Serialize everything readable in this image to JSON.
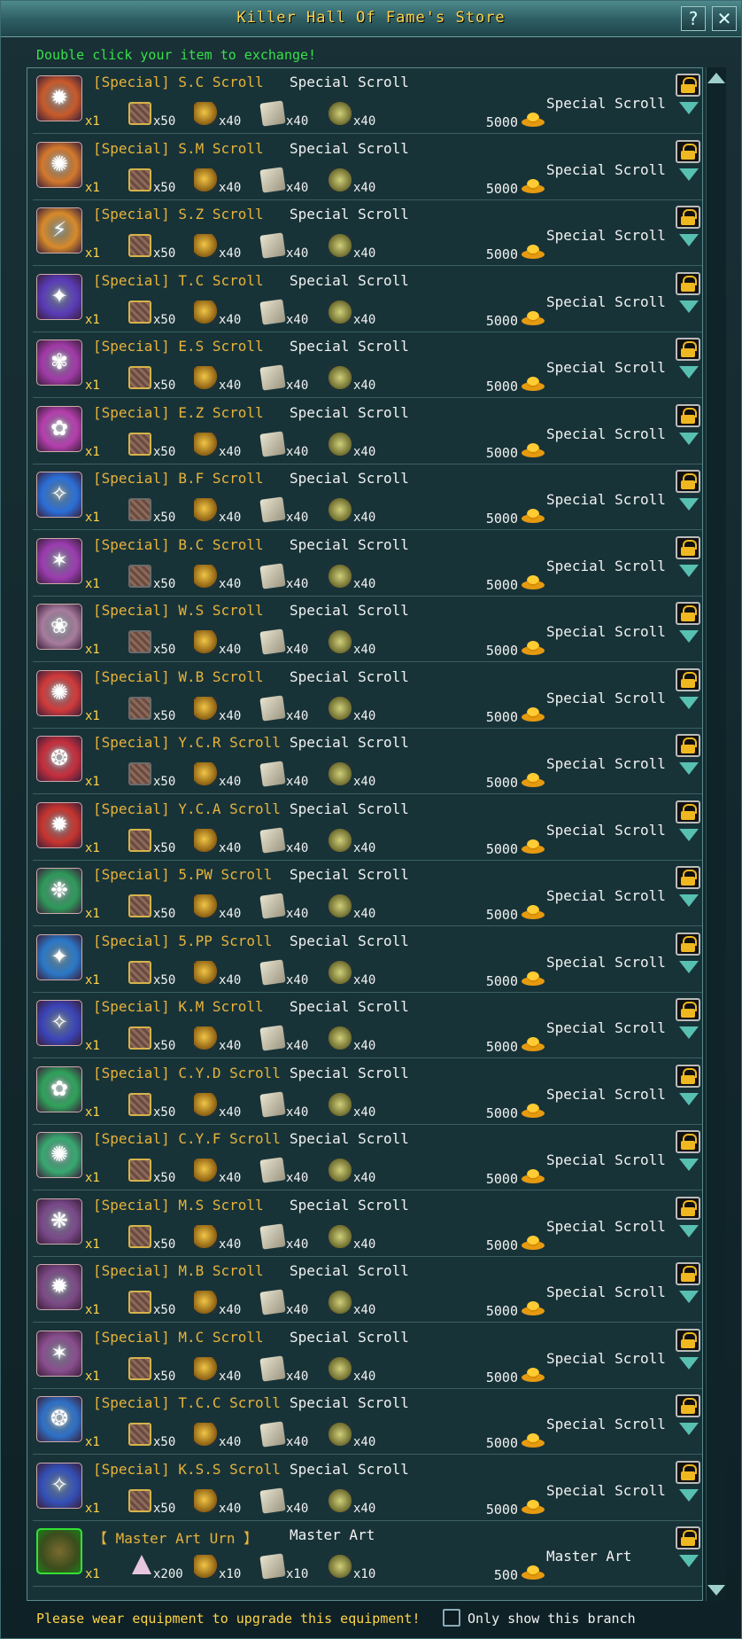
{
  "window": {
    "title": "Killer Hall Of Fame's Store",
    "help_glyph": "?",
    "close_glyph": "✕"
  },
  "hint_top": "Double click your item to exchange!",
  "footer": {
    "hint": "Please wear equipment to upgrade this equipment!",
    "checkbox_label": "Only show this branch"
  },
  "colors": {
    "item_name": "#e7b33a",
    "hint_top": "#38e04b",
    "footer_hint": "#ffd34a",
    "lock_icon": "#f0b820",
    "arrow_icon": "#58c0b0"
  },
  "items": [
    {
      "name": "[Special] S.C Scroll",
      "type": "Special Scroll",
      "qty": "x1",
      "mats": [
        "x50",
        "x40",
        "x40",
        "x40"
      ],
      "price": "5000",
      "category": "Special Scroll",
      "icon_color": "#c85a2a",
      "icon": "✹"
    },
    {
      "name": "[Special] S.M Scroll",
      "type": "Special Scroll",
      "qty": "x1",
      "mats": [
        "x50",
        "x40",
        "x40",
        "x40"
      ],
      "price": "5000",
      "category": "Special Scroll",
      "icon_color": "#d4782c",
      "icon": "✺"
    },
    {
      "name": "[Special] S.Z Scroll",
      "type": "Special Scroll",
      "qty": "x1",
      "mats": [
        "x50",
        "x40",
        "x40",
        "x40"
      ],
      "price": "5000",
      "category": "Special Scroll",
      "icon_color": "#d88a2a",
      "icon": "⚡"
    },
    {
      "name": "[Special] T.C Scroll",
      "type": "Special Scroll",
      "qty": "x1",
      "mats": [
        "x50",
        "x40",
        "x40",
        "x40"
      ],
      "price": "5000",
      "category": "Special Scroll",
      "icon_color": "#5a3bb8",
      "icon": "✦"
    },
    {
      "name": "[Special] E.S Scroll",
      "type": "Special Scroll",
      "qty": "x1",
      "mats": [
        "x50",
        "x40",
        "x40",
        "x40"
      ],
      "price": "5000",
      "category": "Special Scroll",
      "icon_color": "#a23aa8",
      "icon": "✾"
    },
    {
      "name": "[Special] E.Z Scroll",
      "type": "Special Scroll",
      "qty": "x1",
      "mats": [
        "x50",
        "x40",
        "x40",
        "x40"
      ],
      "price": "5000",
      "category": "Special Scroll",
      "icon_color": "#b63fae",
      "icon": "✿"
    },
    {
      "name": "[Special] B.F Scroll",
      "type": "Special Scroll",
      "qty": "x1",
      "mats": [
        "x50",
        "x40",
        "x40",
        "x40"
      ],
      "price": "5000",
      "category": "Special Scroll",
      "icon_color": "#2a6fd8",
      "icon": "✧"
    },
    {
      "name": "[Special] B.C Scroll",
      "type": "Special Scroll",
      "qty": "x1",
      "mats": [
        "x50",
        "x40",
        "x40",
        "x40"
      ],
      "price": "5000",
      "category": "Special Scroll",
      "icon_color": "#9c3cb0",
      "icon": "✶"
    },
    {
      "name": "[Special] W.S Scroll",
      "type": "Special Scroll",
      "qty": "x1",
      "mats": [
        "x50",
        "x40",
        "x40",
        "x40"
      ],
      "price": "5000",
      "category": "Special Scroll",
      "icon_color": "#a77c9c",
      "icon": "❀"
    },
    {
      "name": "[Special] W.B Scroll",
      "type": "Special Scroll",
      "qty": "x1",
      "mats": [
        "x50",
        "x40",
        "x40",
        "x40"
      ],
      "price": "5000",
      "category": "Special Scroll",
      "icon_color": "#d23a3a",
      "icon": "✺"
    },
    {
      "name": "[Special] Y.C.R Scroll",
      "type": "Special Scroll",
      "qty": "x1",
      "mats": [
        "x50",
        "x40",
        "x40",
        "x40"
      ],
      "price": "5000",
      "category": "Special Scroll",
      "icon_color": "#c62e3c",
      "icon": "❂"
    },
    {
      "name": "[Special] Y.C.A Scroll",
      "type": "Special Scroll",
      "qty": "x1",
      "mats": [
        "x50",
        "x40",
        "x40",
        "x40"
      ],
      "price": "5000",
      "category": "Special Scroll",
      "icon_color": "#c8342e",
      "icon": "✹"
    },
    {
      "name": "[Special] 5.PW Scroll",
      "type": "Special Scroll",
      "qty": "x1",
      "mats": [
        "x50",
        "x40",
        "x40",
        "x40"
      ],
      "price": "5000",
      "category": "Special Scroll",
      "icon_color": "#2e9a5a",
      "icon": "❉"
    },
    {
      "name": "[Special] 5.PP Scroll",
      "type": "Special Scroll",
      "qty": "x1",
      "mats": [
        "x50",
        "x40",
        "x40",
        "x40"
      ],
      "price": "5000",
      "category": "Special Scroll",
      "icon_color": "#2a78c8",
      "icon": "✦"
    },
    {
      "name": "[Special] K.M Scroll",
      "type": "Special Scroll",
      "qty": "x1",
      "mats": [
        "x50",
        "x40",
        "x40",
        "x40"
      ],
      "price": "5000",
      "category": "Special Scroll",
      "icon_color": "#3a44b8",
      "icon": "✧"
    },
    {
      "name": "[Special] C.Y.D Scroll",
      "type": "Special Scroll",
      "qty": "x1",
      "mats": [
        "x50",
        "x40",
        "x40",
        "x40"
      ],
      "price": "5000",
      "category": "Special Scroll",
      "icon_color": "#2fa25a",
      "icon": "✿"
    },
    {
      "name": "[Special] C.Y.F Scroll",
      "type": "Special Scroll",
      "qty": "x1",
      "mats": [
        "x50",
        "x40",
        "x40",
        "x40"
      ],
      "price": "5000",
      "category": "Special Scroll",
      "icon_color": "#38a870",
      "icon": "✺"
    },
    {
      "name": "[Special] M.S Scroll",
      "type": "Special Scroll",
      "qty": "x1",
      "mats": [
        "x50",
        "x40",
        "x40",
        "x40"
      ],
      "price": "5000",
      "category": "Special Scroll",
      "icon_color": "#7a4a8a",
      "icon": "❋"
    },
    {
      "name": "[Special] M.B Scroll",
      "type": "Special Scroll",
      "qty": "x1",
      "mats": [
        "x50",
        "x40",
        "x40",
        "x40"
      ],
      "price": "5000",
      "category": "Special Scroll",
      "icon_color": "#7c4a86",
      "icon": "✹"
    },
    {
      "name": "[Special] M.C Scroll",
      "type": "Special Scroll",
      "qty": "x1",
      "mats": [
        "x50",
        "x40",
        "x40",
        "x40"
      ],
      "price": "5000",
      "category": "Special Scroll",
      "icon_color": "#8a4e8e",
      "icon": "✶"
    },
    {
      "name": "[Special] T.C.C Scroll",
      "type": "Special Scroll",
      "qty": "x1",
      "mats": [
        "x50",
        "x40",
        "x40",
        "x40"
      ],
      "price": "5000",
      "category": "Special Scroll",
      "icon_color": "#2e70c6",
      "icon": "❂"
    },
    {
      "name": "[Special] K.S.S Scroll",
      "type": "Special Scroll",
      "qty": "x1",
      "mats": [
        "x50",
        "x40",
        "x40",
        "x40"
      ],
      "price": "5000",
      "category": "Special Scroll",
      "icon_color": "#3350b8",
      "icon": "✧"
    }
  ],
  "master_item": {
    "name": "【 Master Art Urn 】",
    "type": "Master Art",
    "qty": "x1",
    "mats": [
      "x200",
      "x10",
      "x10",
      "x10"
    ],
    "price": "500",
    "category": "Master Art",
    "icon": "urn-icon"
  }
}
